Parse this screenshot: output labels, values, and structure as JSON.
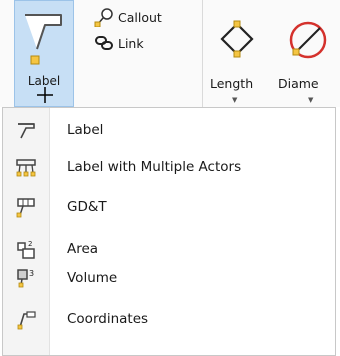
{
  "ribbon": {
    "label_button": "Label",
    "callout_label": "Callout",
    "link_label": "Link",
    "length_label": "Length",
    "diameter_label": "Diame"
  },
  "menu": {
    "items": [
      {
        "label": "Label",
        "icon": "label-icon"
      },
      {
        "label": "Label with Multiple Actors",
        "icon": "label-multiple-actors-icon"
      },
      {
        "label": "GD&T",
        "icon": "gdt-icon"
      },
      {
        "label": "Area",
        "icon": "area-icon"
      },
      {
        "label": "Volume",
        "icon": "volume-icon"
      },
      {
        "label": "Coordinates",
        "icon": "coordinates-icon"
      }
    ]
  },
  "colors": {
    "highlight": "#c7dff5",
    "accent_orange": "#f0a020",
    "danger_red": "#d4312c"
  }
}
